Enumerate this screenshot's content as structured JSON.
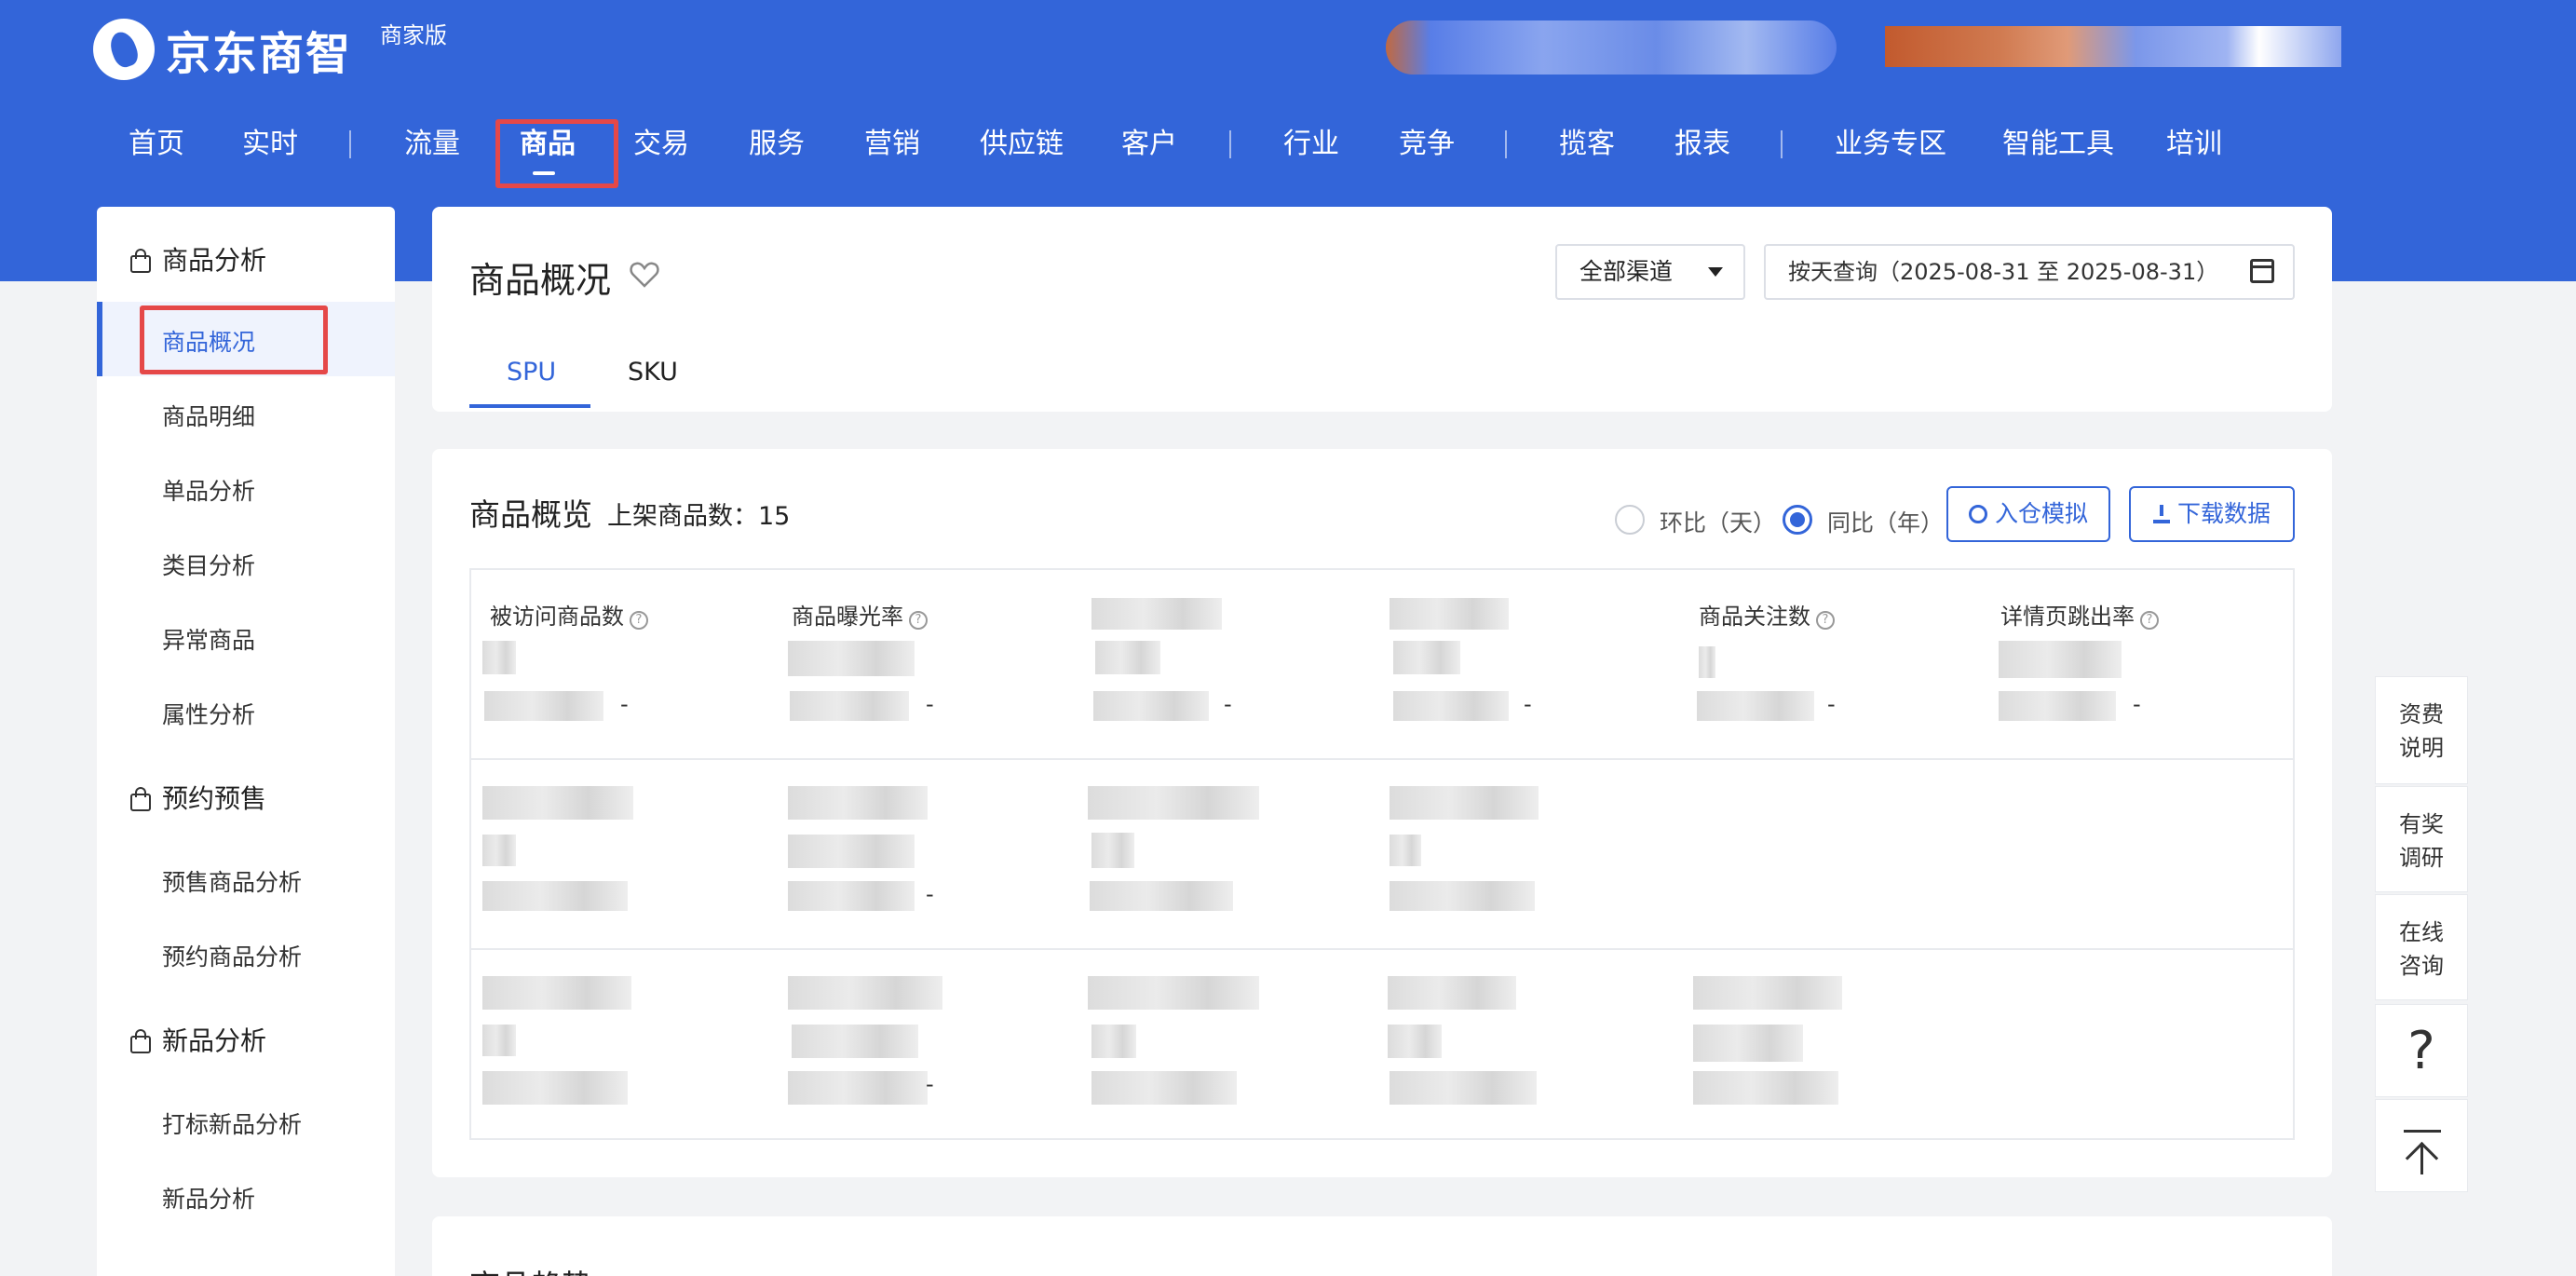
{
  "header": {
    "logo_text": "京东商智",
    "edition": "商家版",
    "nav": [
      {
        "label": "首页"
      },
      {
        "label": "实时"
      },
      {
        "label": "流量"
      },
      {
        "label": "商品"
      },
      {
        "label": "交易"
      },
      {
        "label": "服务"
      },
      {
        "label": "营销"
      },
      {
        "label": "供应链"
      },
      {
        "label": "客户"
      },
      {
        "label": "行业"
      },
      {
        "label": "竞争"
      },
      {
        "label": "揽客"
      },
      {
        "label": "报表"
      },
      {
        "label": "业务专区"
      },
      {
        "label": "智能工具"
      },
      {
        "label": "培训"
      }
    ],
    "active_nav": "商品"
  },
  "sidebar": {
    "groups": [
      {
        "title": "商品分析",
        "items": [
          "商品概况",
          "商品明细",
          "单品分析",
          "类目分析",
          "异常商品",
          "属性分析"
        ]
      },
      {
        "title": "预约预售",
        "items": [
          "预售商品分析",
          "预约商品分析"
        ]
      },
      {
        "title": "新品分析",
        "items": [
          "打标新品分析",
          "新品分析"
        ]
      }
    ],
    "active_item": "商品概况"
  },
  "page": {
    "title": "商品概况",
    "channel_select": "全部渠道",
    "date_range": "按天查询（2025-08-31 至 2025-08-31）",
    "tabs": [
      "SPU",
      "SKU"
    ],
    "active_tab": "SPU"
  },
  "overview": {
    "title": "商品概览",
    "listed_label": "上架商品数：",
    "listed_count": "15",
    "compare_options": [
      "环比（天）",
      "同比（年）"
    ],
    "compare_selected": "同比（年）",
    "btn_simulate": "入仓模拟",
    "btn_download": "下载数据",
    "metrics_row1": [
      {
        "label": "被访问商品数",
        "change": "-"
      },
      {
        "label": "商品曝光率",
        "change": "-"
      },
      {
        "label": "",
        "change": "-"
      },
      {
        "label": "",
        "change": "-"
      },
      {
        "label": "商品关注数",
        "change": "-"
      },
      {
        "label": "详情页跳出率",
        "change": "-"
      }
    ],
    "dash": "-"
  },
  "trend": {
    "title": "商品趋势"
  },
  "float_bar": {
    "fee": "资费说明",
    "survey": "有奖调研",
    "consult": "在线咨询",
    "help": "?"
  },
  "colors": {
    "brand": "#3365d9",
    "highlight": "#e54848"
  }
}
